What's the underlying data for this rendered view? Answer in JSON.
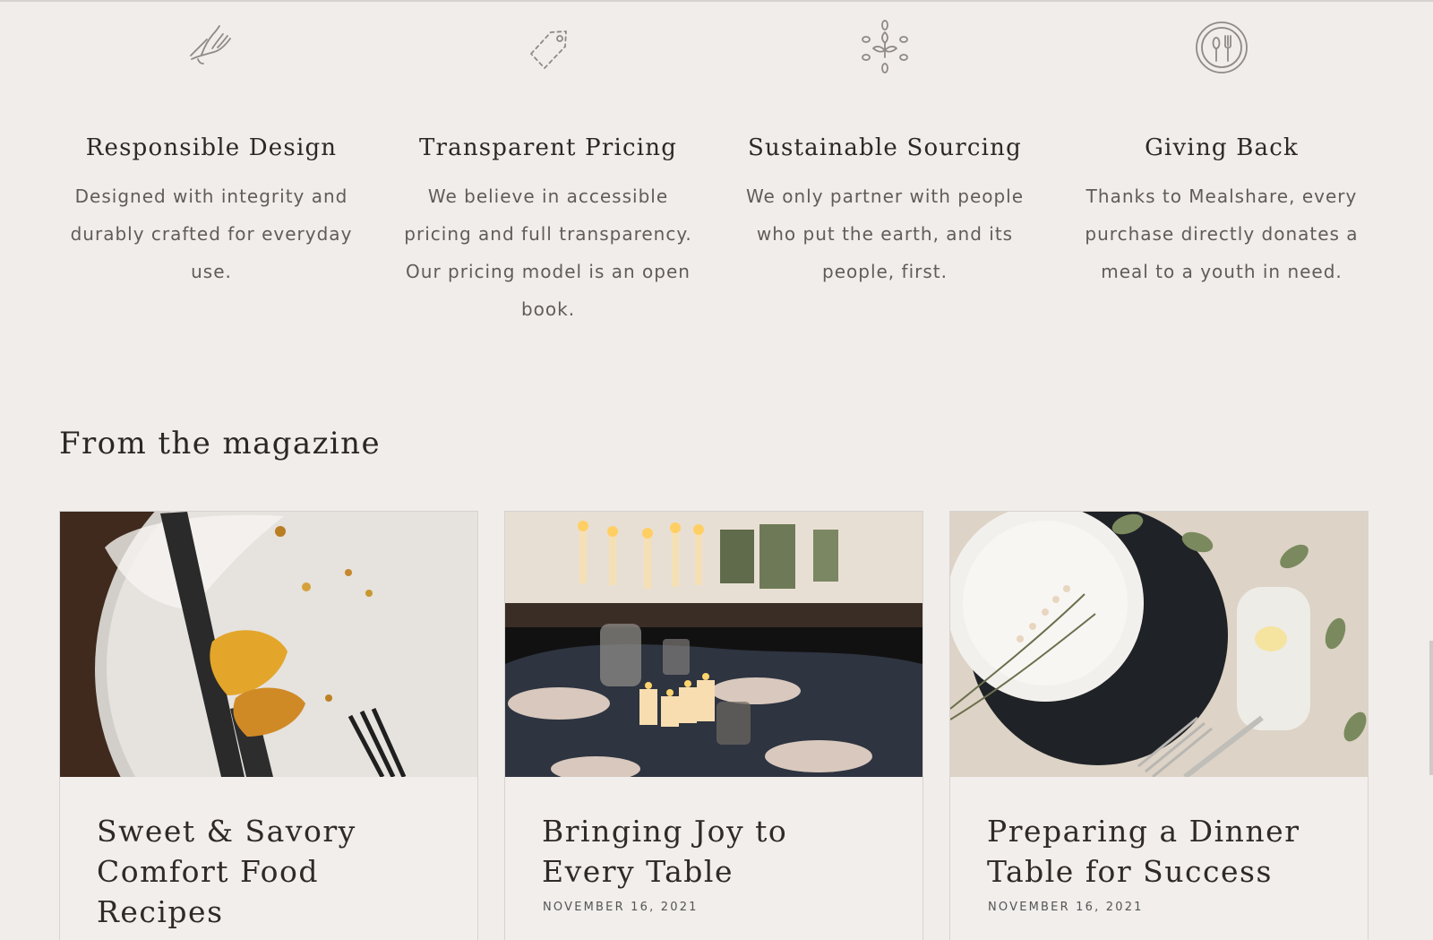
{
  "features": [
    {
      "icon": "hand-icon",
      "title": "Responsible Design",
      "text": "Designed with integrity and durably crafted for everyday use."
    },
    {
      "icon": "price-tag-icon",
      "title": "Transparent Pricing",
      "text": "We believe in accessible pricing and full transparency. Our pricing model is an open book."
    },
    {
      "icon": "leaf-sprout-icon",
      "title": "Sustainable Sourcing",
      "text": "We only partner with people who put the earth, and its people, first."
    },
    {
      "icon": "plate-fork-spoon-icon",
      "title": "Giving Back",
      "text": "Thanks to Mealshare, every purchase directly donates a meal to a youth in need."
    }
  ],
  "magazine": {
    "title": "From the magazine",
    "articles": [
      {
        "title": "Sweet & Savory Comfort Food Recipes",
        "date": "",
        "image": "plate-with-food-remains-image"
      },
      {
        "title": "Bringing Joy to Every Table",
        "date": "NOVEMBER 16, 2021",
        "image": "candlelit-dinner-table-image"
      },
      {
        "title": "Preparing a Dinner Table for Success",
        "date": "NOVEMBER 16, 2021",
        "image": "table-setting-with-plates-image"
      }
    ]
  },
  "colors": {
    "background": "#f0edeb",
    "text": "#2f2b29",
    "muted_text": "#615c59",
    "icon": "#8f8a87"
  }
}
